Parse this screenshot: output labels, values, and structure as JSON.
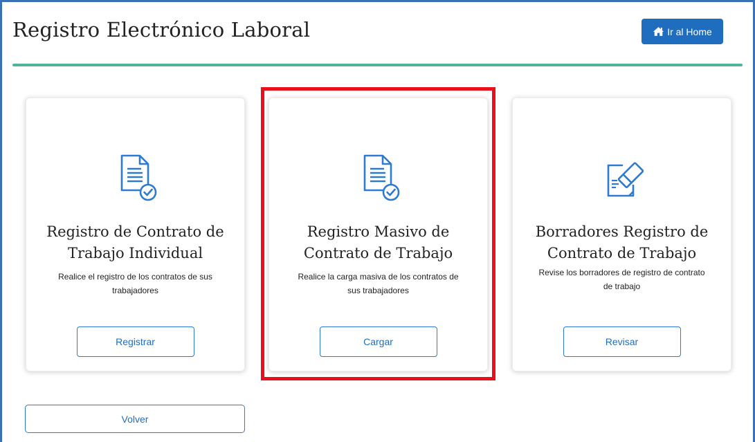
{
  "header": {
    "title": "Registro Electrónico Laboral",
    "home_button": "Ir al Home",
    "home_icon": "home-icon",
    "accent_color": "#52b39b",
    "brand_color": "#1f6dbf"
  },
  "cards": [
    {
      "icon": "document-check-icon",
      "title_line1": "Registro de Contrato de",
      "title_line2": "Trabajo Individual",
      "desc_line1": "Realice el registro de los contratos de sus",
      "desc_line2": "trabajadores",
      "button": "Registrar",
      "highlighted": false
    },
    {
      "icon": "document-check-icon",
      "title_line1": "Registro Masivo de",
      "title_line2": "Contrato de Trabajo",
      "desc_line1": "Realice la carga masiva de los contratos de",
      "desc_line2": "sus trabajadores",
      "button": "Cargar",
      "highlighted": true
    },
    {
      "icon": "document-eraser-icon",
      "title_line1": "Borradores Registro de",
      "title_line2": "Contrato de Trabajo",
      "desc_line1": "Revise los borradores de registro de contrato",
      "desc_line2": "de trabajo",
      "button": "Revisar",
      "highlighted": false
    }
  ],
  "footer": {
    "back_button": "Volver"
  },
  "highlight_color": "#e8101a"
}
